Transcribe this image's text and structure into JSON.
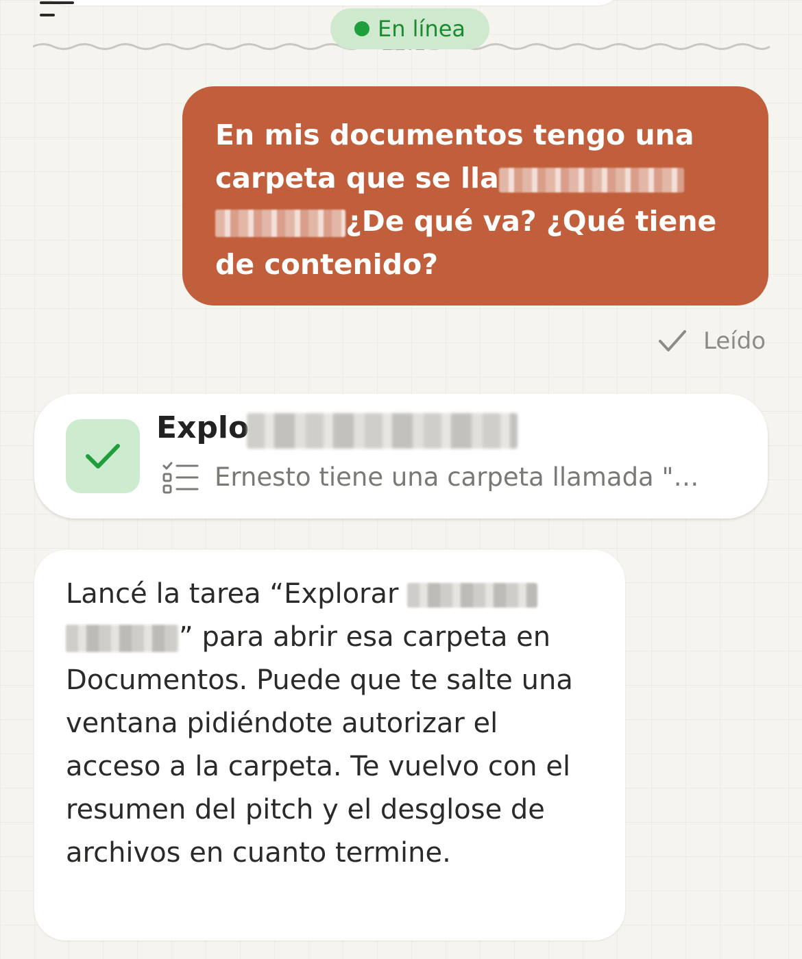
{
  "header": {
    "status": {
      "label": "En línea",
      "dot_color": "#1f9e3b"
    },
    "menu_icon": "hamburger-menu-icon",
    "timestamp_partial": "11:18"
  },
  "messages": [
    {
      "role": "user",
      "text_before_redaction": "En mis documentos tengo una carpeta que se lla",
      "text_after_redaction": "De qué va? ¿Qué tiene de contenido?",
      "color": "#c15f3c"
    },
    {
      "role": "status",
      "read_receipt": "Leído",
      "icon": "check-icon"
    },
    {
      "role": "task",
      "title_visible": "Explo",
      "status_icon": "check-icon",
      "summary_icon": "checklist-icon",
      "summary": "Ernesto tiene una carpeta llamada \"…"
    },
    {
      "role": "assistant",
      "text_before_redaction": "Lancé la tarea “Explorar",
      "text_after_redaction": "para abrir esa carpeta en Documentos. Puede que te salte una ventana pidiéndote autorizar el acceso a la carpeta. Te vuelvo con el resumen del pitch y el desglose de archivos en cuanto termine."
    }
  ]
}
